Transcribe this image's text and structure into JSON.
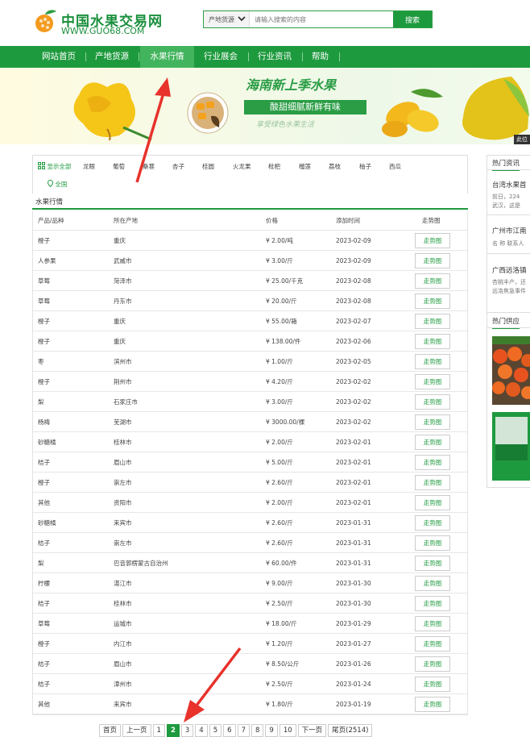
{
  "header": {
    "logo_title": "中国水果交易网",
    "logo_url": "WWW.GUO68.COM",
    "search": {
      "category": "产地货源",
      "placeholder": "请输入搜索的内容",
      "button": "搜索"
    }
  },
  "nav": [
    "网站首页",
    "产地货源",
    "水果行情",
    "行业展会",
    "行业资讯",
    "帮助"
  ],
  "banner": {
    "title": "海南新上季水果",
    "slogan": "酸甜细腻新鲜有味",
    "subtitle": "享受绿色水果生活",
    "tag": "此位"
  },
  "filters": {
    "show_all": "显示全部",
    "fruits": [
      "龙眼",
      "葡萄",
      "桑葚",
      "杏子",
      "桂圆",
      "火龙果",
      "枇杷",
      "榴莲",
      "荔枝",
      "柚子",
      "西瓜"
    ],
    "region": "全国"
  },
  "section": {
    "title": "水果行情"
  },
  "table": {
    "headers": [
      "产品/品种",
      "所在产地",
      "价格",
      "添加时间",
      "走势图"
    ],
    "trend_label": "走势图",
    "rows": [
      [
        "橙子",
        "重庆",
        "¥ 2.00/吨",
        "2023-02-09"
      ],
      [
        "人参果",
        "武威市",
        "¥ 3.00/斤",
        "2023-02-09"
      ],
      [
        "草莓",
        "菏泽市",
        "¥ 25.00/千克",
        "2023-02-08"
      ],
      [
        "草莓",
        "丹东市",
        "¥ 20.00/斤",
        "2023-02-08"
      ],
      [
        "橙子",
        "重庆",
        "¥ 55.00/箱",
        "2023-02-07"
      ],
      [
        "橙子",
        "重庆",
        "¥ 138.00/件",
        "2023-02-06"
      ],
      [
        "枣",
        "滨州市",
        "¥ 1.00/斤",
        "2023-02-05"
      ],
      [
        "橙子",
        "荆州市",
        "¥ 4.20/斤",
        "2023-02-02"
      ],
      [
        "梨",
        "石家庄市",
        "¥ 3.00/斤",
        "2023-02-02"
      ],
      [
        "杨梅",
        "芜湖市",
        "¥ 3000.00/棵",
        "2023-02-02"
      ],
      [
        "砂糖橘",
        "桂林市",
        "¥ 2.00/斤",
        "2023-02-01"
      ],
      [
        "桔子",
        "眉山市",
        "¥ 5.00/斤",
        "2023-02-01"
      ],
      [
        "橙子",
        "崇左市",
        "¥ 2.60/斤",
        "2023-02-01"
      ],
      [
        "其他",
        "资阳市",
        "¥ 2.00/斤",
        "2023-02-01"
      ],
      [
        "砂糖橘",
        "来宾市",
        "¥ 2.60/斤",
        "2023-01-31"
      ],
      [
        "桔子",
        "崇左市",
        "¥ 2.60/斤",
        "2023-01-31"
      ],
      [
        "梨",
        "巴音郭楞蒙古自治州",
        "¥ 60.00/件",
        "2023-01-31"
      ],
      [
        "柠檬",
        "湛江市",
        "¥ 9.00/斤",
        "2023-01-30"
      ],
      [
        "桔子",
        "桂林市",
        "¥ 2.50/斤",
        "2023-01-30"
      ],
      [
        "草莓",
        "运城市",
        "¥ 18.00/斤",
        "2023-01-29"
      ],
      [
        "橙子",
        "内江市",
        "¥ 1.20/斤",
        "2023-01-27"
      ],
      [
        "桔子",
        "眉山市",
        "¥ 8.50/公斤",
        "2023-01-26"
      ],
      [
        "桔子",
        "漳州市",
        "¥ 2.50/斤",
        "2023-01-24"
      ],
      [
        "其他",
        "来宾市",
        "¥ 1.80/斤",
        "2023-01-19"
      ]
    ]
  },
  "pager": [
    "首页",
    "上一页",
    "1",
    "2",
    "3",
    "4",
    "5",
    "6",
    "7",
    "8",
    "9",
    "10",
    "下一页",
    "尾页(2514)"
  ],
  "pager_current": "2",
  "sidebar": {
    "news_title": "热门资讯",
    "news": [
      {
        "title": "台湾水果首",
        "summary": [
          "前日，224",
          "武汉，这是"
        ]
      },
      {
        "title": "广州市江南",
        "summary": [
          "名 称 联系人"
        ]
      },
      {
        "title": "广西远洛镇",
        "summary": [
          "杏桃丰产，还",
          "远洛焦急事件"
        ]
      }
    ],
    "supply_title": "热门供应"
  },
  "colors": {
    "brand_green": "#1e9a3e",
    "nav_active": "#43b45e",
    "annotation_red": "#e8322b"
  }
}
